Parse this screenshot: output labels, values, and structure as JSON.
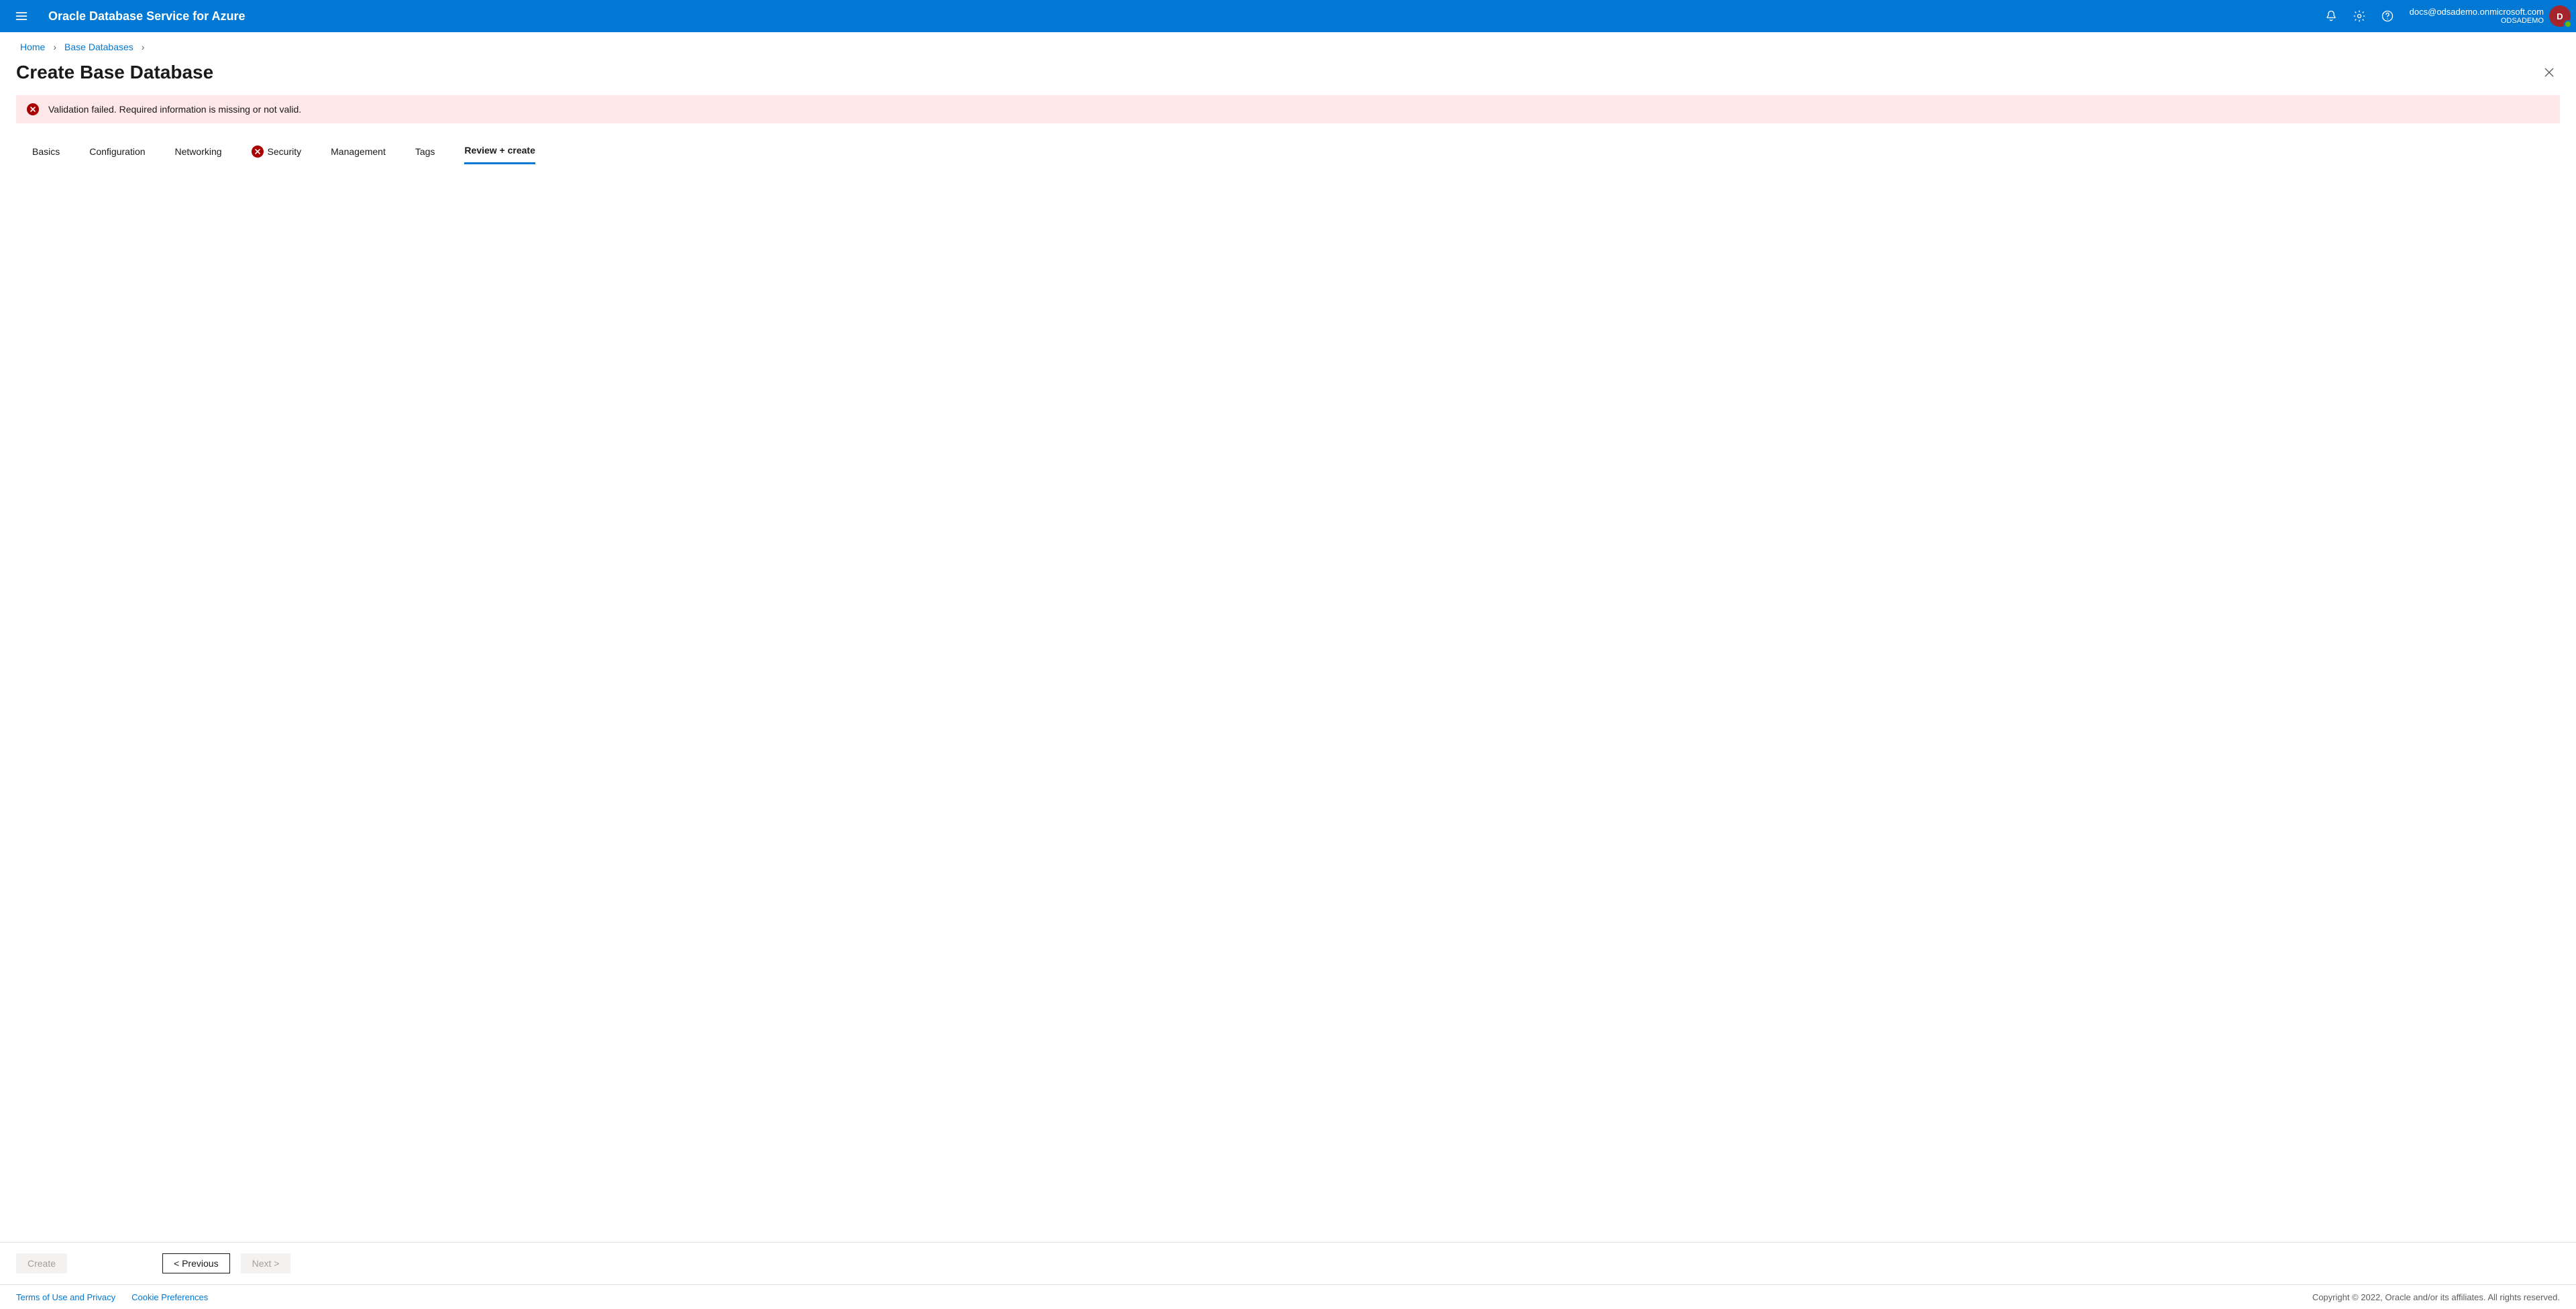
{
  "header": {
    "title": "Oracle Database Service for Azure",
    "account": {
      "email": "docs@odsademo.onmicrosoft.com",
      "org": "ODSADEMO",
      "avatar_initial": "D"
    }
  },
  "breadcrumb": {
    "items": [
      "Home",
      "Base Databases"
    ]
  },
  "page": {
    "title": "Create Base Database"
  },
  "alert": {
    "message": "Validation failed. Required information is missing or not valid."
  },
  "tabs": {
    "items": [
      {
        "label": "Basics"
      },
      {
        "label": "Configuration"
      },
      {
        "label": "Networking"
      },
      {
        "label": "Security",
        "has_error": true
      },
      {
        "label": "Management"
      },
      {
        "label": "Tags"
      },
      {
        "label": "Review + create",
        "active": true
      }
    ]
  },
  "buttons": {
    "create": "Create",
    "previous": "< Previous",
    "next": "Next >"
  },
  "footer": {
    "terms": "Terms of Use and Privacy",
    "cookies": "Cookie Preferences",
    "copyright": "Copyright © 2022, Oracle and/or its affiliates. All rights reserved."
  }
}
